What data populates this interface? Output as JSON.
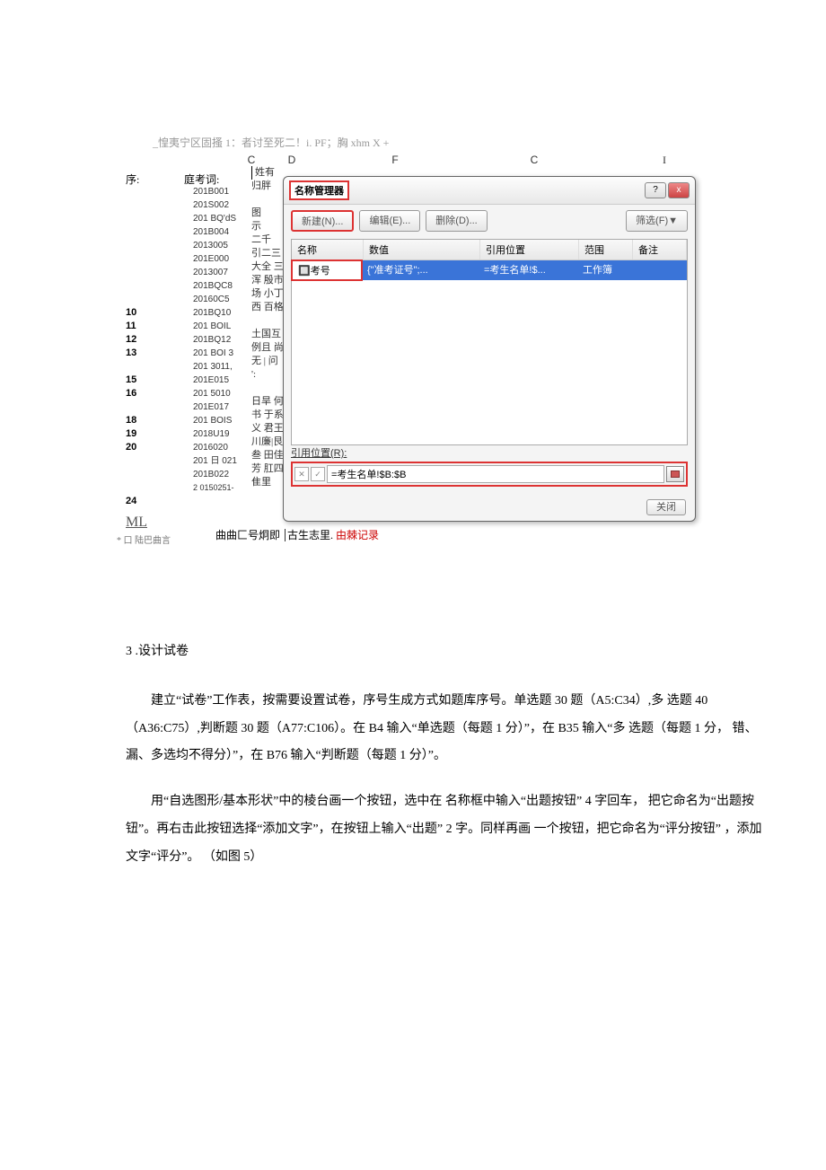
{
  "caption": "_惶夷宁区固搔 1：者讨至死二！i. PF；胸 xhm X +",
  "col_headers": {
    "c": "C",
    "d": "D",
    "f": "F",
    "c2": "C",
    "i": "I"
  },
  "left": {
    "seq": "序:",
    "court": "庭考词:",
    "codes": [
      "201B001",
      "201S002",
      "201 BQ'dS",
      "201B004",
      "2013005",
      "201E000",
      "2013007",
      "201BQC8",
      "20160C5",
      "201BQ10",
      "201 BOIL",
      "201BQ12",
      "201 BOI 3",
      "201  3011,",
      "201E015",
      "201 5010",
      "201E017",
      "201 BOIS",
      "2018U19",
      "2016020",
      "201 日 021",
      "201B022",
      "2 0150251-"
    ],
    "names_head": "姓有",
    "names": [
      "归胖",
      "",
      "图",
      "示",
      "二千",
      "引二三",
      "大全 三",
      "浑 殷市",
      "场 小丁",
      "西 百格",
      "",
      "土国互",
      "例且 尚",
      "无 | 问",
      "':",
      "",
      "日旱 何",
      "书 于系",
      "义 君王",
      "川廉|艮",
      "叁 田佳",
      "芳 肛四",
      "隹里"
    ],
    "rows_a": [
      "10",
      "11",
      "12",
      "13",
      "",
      "15",
      "16",
      "",
      "18",
      "19",
      "20"
    ],
    "row_24": "24",
    "ml": "ML",
    "footer": "* 口 陆巴曲言",
    "bottom1": "曲曲匚号炯即",
    "bottom2": "古生志里.",
    "bottom3": "由棘记录"
  },
  "dialog": {
    "title": "名称管理器",
    "help": "?",
    "close_x": "x",
    "new_btn": "新建(N)...",
    "edit_btn": "编辑(E)...",
    "del_btn": "删除(D)...",
    "filter_btn": "筛选(F)▼",
    "hdr_name": "名称",
    "hdr_value": "数值",
    "hdr_ref": "引用位置",
    "hdr_scope": "范围",
    "hdr_note": "备注",
    "row_name": "🔲考号",
    "row_value": "{\"准考证号\";...",
    "row_ref": "=考生名单!$...",
    "row_scope": "工作簿",
    "ref_label": "引用位置(R):",
    "ref_btn_x": "✕",
    "ref_btn_ok": "✓",
    "ref_value": "=考生名单!$B:$B",
    "close_btn": "关闭"
  },
  "text": {
    "h3": "3 .设计试卷",
    "p1": "建立“试卷”工作表，按需要设置试卷，序号生成方式如题库序号。单选题 30 题（A5:C34）,多 选题 40（A36:C75）,判断题 30 题（A77:C106）。在 B4 输入“单选题（每题 1 分）”，在 B35 输入“多 选题（每题 1 分， 错、漏、多选均不得分）”，在  B76 输入“判断题（每题 1 分）”。",
    "p2": "用“自选图形/基本形状”中的棱台画一个按钮，选中在 名称框中输入“出题按钮”  4 字回车， 把它命名为“出题按钮”。再右击此按钮选择“添加文字”，在按钮上输入“出题”  2 字。同样再画 一个按钮，把它命名为“评分按钮” ，添加文字“评分”。 （如图 5）"
  }
}
